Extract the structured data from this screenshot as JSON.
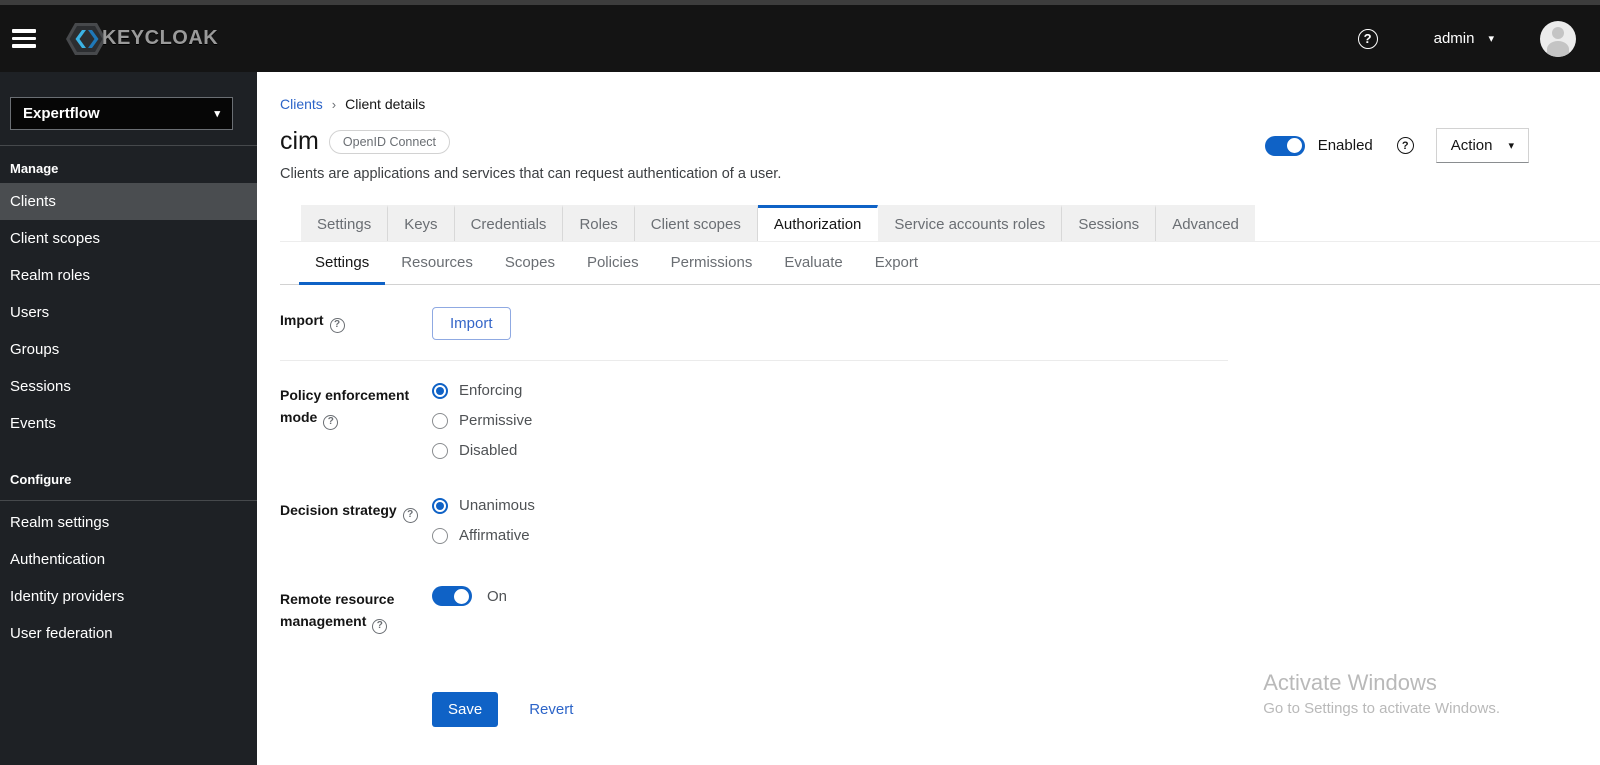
{
  "colors": {
    "accent_blue": "#0f62c6",
    "link_blue": "#2c64c8",
    "masthead_bg": "#141414",
    "sidebar_bg": "#1e2125",
    "sidebar_selected": "#4a4d50",
    "tab_inactive_bg": "#f0f0f0"
  },
  "icons": {
    "help": "?",
    "caret_down": "▾",
    "breadcrumb_separator": "›"
  },
  "header": {
    "logo_text": "KEYCLOAK",
    "username": "admin"
  },
  "sidebar": {
    "realm_selector": {
      "value": "Expertflow"
    },
    "sections": [
      {
        "title": "Manage",
        "items": [
          {
            "label": "Clients",
            "active": true
          },
          {
            "label": "Client scopes",
            "active": false
          },
          {
            "label": "Realm roles",
            "active": false
          },
          {
            "label": "Users",
            "active": false
          },
          {
            "label": "Groups",
            "active": false
          },
          {
            "label": "Sessions",
            "active": false
          },
          {
            "label": "Events",
            "active": false
          }
        ]
      },
      {
        "title": "Configure",
        "items": [
          {
            "label": "Realm settings",
            "active": false
          },
          {
            "label": "Authentication",
            "active": false
          },
          {
            "label": "Identity providers",
            "active": false
          },
          {
            "label": "User federation",
            "active": false
          }
        ]
      }
    ]
  },
  "page": {
    "breadcrumb": {
      "parent": "Clients",
      "current": "Client details"
    },
    "title": "cim",
    "badge": "OpenID Connect",
    "description": "Clients are applications and services that can request authentication of a user.",
    "enabled_toggle": {
      "label": "Enabled",
      "state": "on"
    },
    "action_menu": {
      "label": "Action"
    }
  },
  "tabs": {
    "active": "Authorization",
    "items": [
      {
        "label": "Settings"
      },
      {
        "label": "Keys"
      },
      {
        "label": "Credentials"
      },
      {
        "label": "Roles"
      },
      {
        "label": "Client scopes"
      },
      {
        "label": "Authorization"
      },
      {
        "label": "Service accounts roles"
      },
      {
        "label": "Sessions"
      },
      {
        "label": "Advanced"
      }
    ]
  },
  "subtabs": {
    "active": "Settings",
    "items": [
      {
        "label": "Settings"
      },
      {
        "label": "Resources"
      },
      {
        "label": "Scopes"
      },
      {
        "label": "Policies"
      },
      {
        "label": "Permissions"
      },
      {
        "label": "Evaluate"
      },
      {
        "label": "Export"
      }
    ]
  },
  "form": {
    "import": {
      "label": "Import",
      "button_label": "Import"
    },
    "policy_enforcement_mode": {
      "label": "Policy enforcement mode",
      "options": [
        "Enforcing",
        "Permissive",
        "Disabled"
      ],
      "selected": "Enforcing"
    },
    "decision_strategy": {
      "label": "Decision strategy",
      "options": [
        "Unanimous",
        "Affirmative"
      ],
      "selected": "Unanimous"
    },
    "remote_resource_management": {
      "label": "Remote resource management",
      "state": "on",
      "state_label": "On"
    },
    "actions": {
      "save_label": "Save",
      "revert_label": "Revert"
    }
  },
  "watermark": {
    "title": "Activate Windows",
    "subtitle": "Go to Settings to activate Windows."
  }
}
